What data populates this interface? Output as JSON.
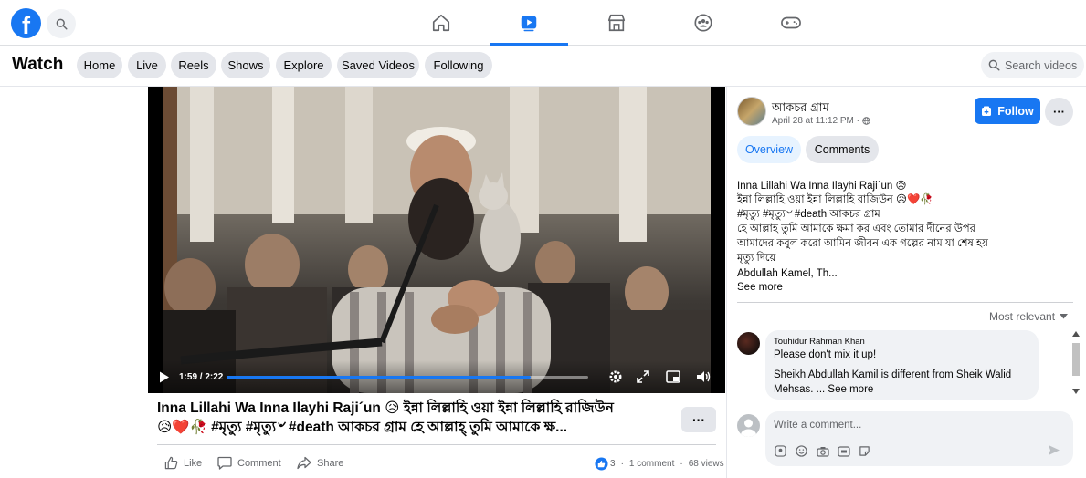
{
  "nav": {
    "logo": "f",
    "icons": [
      "home-icon",
      "watch-icon",
      "marketplace-icon",
      "groups-icon",
      "gaming-icon"
    ],
    "active": "watch-icon",
    "accent": "#1877f2"
  },
  "watch": {
    "title": "Watch",
    "pills": [
      "Home",
      "Live",
      "Reels",
      "Shows",
      "Explore",
      "Saved Videos",
      "Following"
    ],
    "search_placeholder": "Search videos"
  },
  "video": {
    "time": "1:59 / 2:22",
    "progress": 0.84
  },
  "post": {
    "title_line1": "Inna Lillahi Wa Inna Ilayhi Raji´un 😥 ইন্না লিল্লাহি ওয়া ইন্না লিল্লাহি রাজিউন",
    "title_line2": "😥❤️🥀 #মৃত্যু #মৃত্যু৺ #death আকচর গ্রাম হে আল্লাহ্ তুমি আমাকে ক্ষ...",
    "more_label": "···",
    "actions": {
      "like": "Like",
      "comment": "Comment",
      "share": "Share"
    },
    "reaction_count": "3",
    "comments_count": "1 comment",
    "views": "68 views"
  },
  "side": {
    "page_name": "আকচর গ্রাম",
    "date": "April 28 at 11:12 PM ·",
    "follow_label": "Follow",
    "more_label": "···",
    "tabs": [
      "Overview",
      "Comments"
    ],
    "desc_lines": [
      "Inna Lillahi Wa Inna Ilayhi Raji´un 😥",
      "ইন্না লিল্লাহি ওয়া ইন্না লিল্লাহি রাজিউন 😥❤️🥀",
      "#মৃত্যু #মৃত্যু৺ #death আকচর গ্রাম",
      "হে আল্লাহ তুমি আমাকে ক্ষমা কর এবং তোমার দীনের উপর",
      "আমাদের কবুল করো আমিন জীবন এক গল্পের নাম যা শেষ হয়",
      "মৃত্যু দিয়ে",
      "Abdullah Kamel, Th..."
    ],
    "see_more": "See more",
    "sort_label": "Most relevant",
    "comment": {
      "author": "Touhidur Rahman Khan",
      "line1": "Please don't mix it up!",
      "line2": "Sheikh Abdullah Kamil is different from Sheik Walid",
      "line3": "Mehsas. ... See more"
    },
    "write_placeholder": "Write a comment..."
  }
}
